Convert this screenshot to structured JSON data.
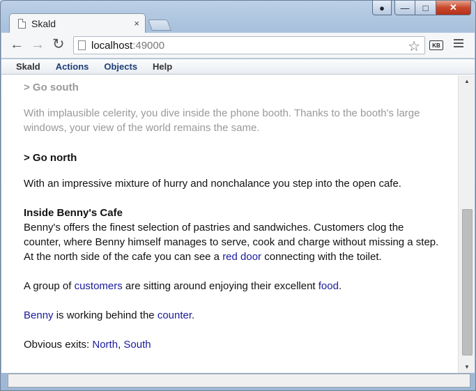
{
  "window": {
    "tab_title": "Skald",
    "tab_close": "×"
  },
  "toolbar": {
    "url_host": "localhost",
    "url_port": ":49000",
    "kb_label": "KB"
  },
  "menu": {
    "items": [
      "Skald",
      "Actions",
      "Objects",
      "Help"
    ]
  },
  "story": {
    "cmd1": "> Go south",
    "text1": "With implausible celerity, you dive inside the phone booth.  Thanks to the booth's large windows, your view of the world remains the same.",
    "cmd2": "> Go north",
    "text2": "With an impressive mixture of hurry and nonchalance you step into the open cafe.",
    "room_title": "Inside Benny's Cafe",
    "room_desc_a": "Benny's offers the finest selection of pastries and sandwiches.  Customers clog the counter, where Benny himself manages to serve, cook and charge without missing a step.  At the north side of the cafe you can see a ",
    "room_link_door": "red door",
    "room_desc_b": " connecting with the toilet.",
    "group_a": "A group of ",
    "link_customers": "customers",
    "group_b": " are sitting around enjoying their excellent ",
    "link_food": "food",
    "group_c": ".",
    "link_benny": "Benny",
    "benny_b": " is working behind the ",
    "link_counter": "counter",
    "benny_c": ".",
    "exits_label": "Obvious exits: ",
    "exit_north": "North",
    "exits_sep": ", ",
    "exit_south": "South"
  },
  "colors": {
    "link": "#1a1a9c",
    "faded_text": "#999999",
    "menu_accent": "#1c3e74"
  }
}
